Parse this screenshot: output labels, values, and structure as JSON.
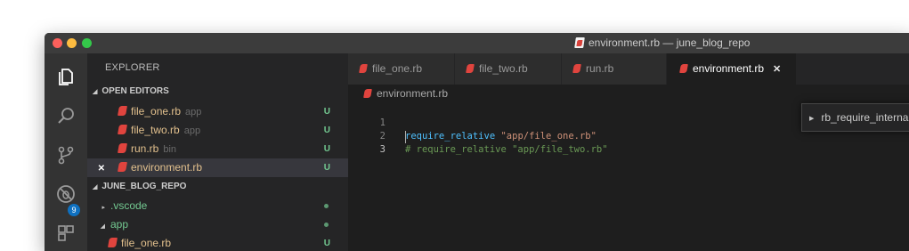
{
  "window": {
    "title": "environment.rb — june_blog_repo"
  },
  "activity_bar": {
    "items": [
      {
        "icon": "files-icon"
      },
      {
        "icon": "search-icon"
      },
      {
        "icon": "source-control-icon",
        "badge": "9"
      },
      {
        "icon": "debug-icon"
      },
      {
        "icon": "extensions-icon"
      }
    ]
  },
  "sidebar": {
    "title": "EXPLORER",
    "open_editors": {
      "label": "OPEN EDITORS",
      "items": [
        {
          "name": "file_one.rb",
          "desc": "app",
          "status": "U"
        },
        {
          "name": "file_two.rb",
          "desc": "app",
          "status": "U"
        },
        {
          "name": "run.rb",
          "desc": "bin",
          "status": "U"
        },
        {
          "name": "environment.rb",
          "desc": "",
          "status": "U",
          "close": "✕"
        }
      ]
    },
    "repo": {
      "label": "JUNE_BLOG_REPO",
      "items": [
        {
          "name": ".vscode",
          "toggle": "▸"
        },
        {
          "name": "app",
          "toggle": "◢"
        },
        {
          "name": "file_one.rb",
          "status": "U"
        }
      ]
    }
  },
  "tabs": [
    {
      "label": "file_one.rb"
    },
    {
      "label": "file_two.rb"
    },
    {
      "label": "run.rb"
    },
    {
      "label": "environment.rb",
      "active": true,
      "close": "✕"
    }
  ],
  "breadcrumb": {
    "file": "environment.rb"
  },
  "editor": {
    "lines": [
      {
        "num": "1",
        "keyword": "require_relative",
        "string": "\"app/file_one.rb\"",
        "comment": ""
      },
      {
        "num": "2",
        "keyword": "",
        "string": "",
        "comment": "# require_relative \"app/file_two.rb\""
      },
      {
        "num": "3",
        "keyword": "",
        "string": "",
        "comment": ""
      }
    ]
  },
  "peek": {
    "label": "rb_require_internal"
  },
  "colors": {
    "ruby_icon": "#e0443e",
    "untracked": "#73c991",
    "badge": "#0e70c0"
  }
}
